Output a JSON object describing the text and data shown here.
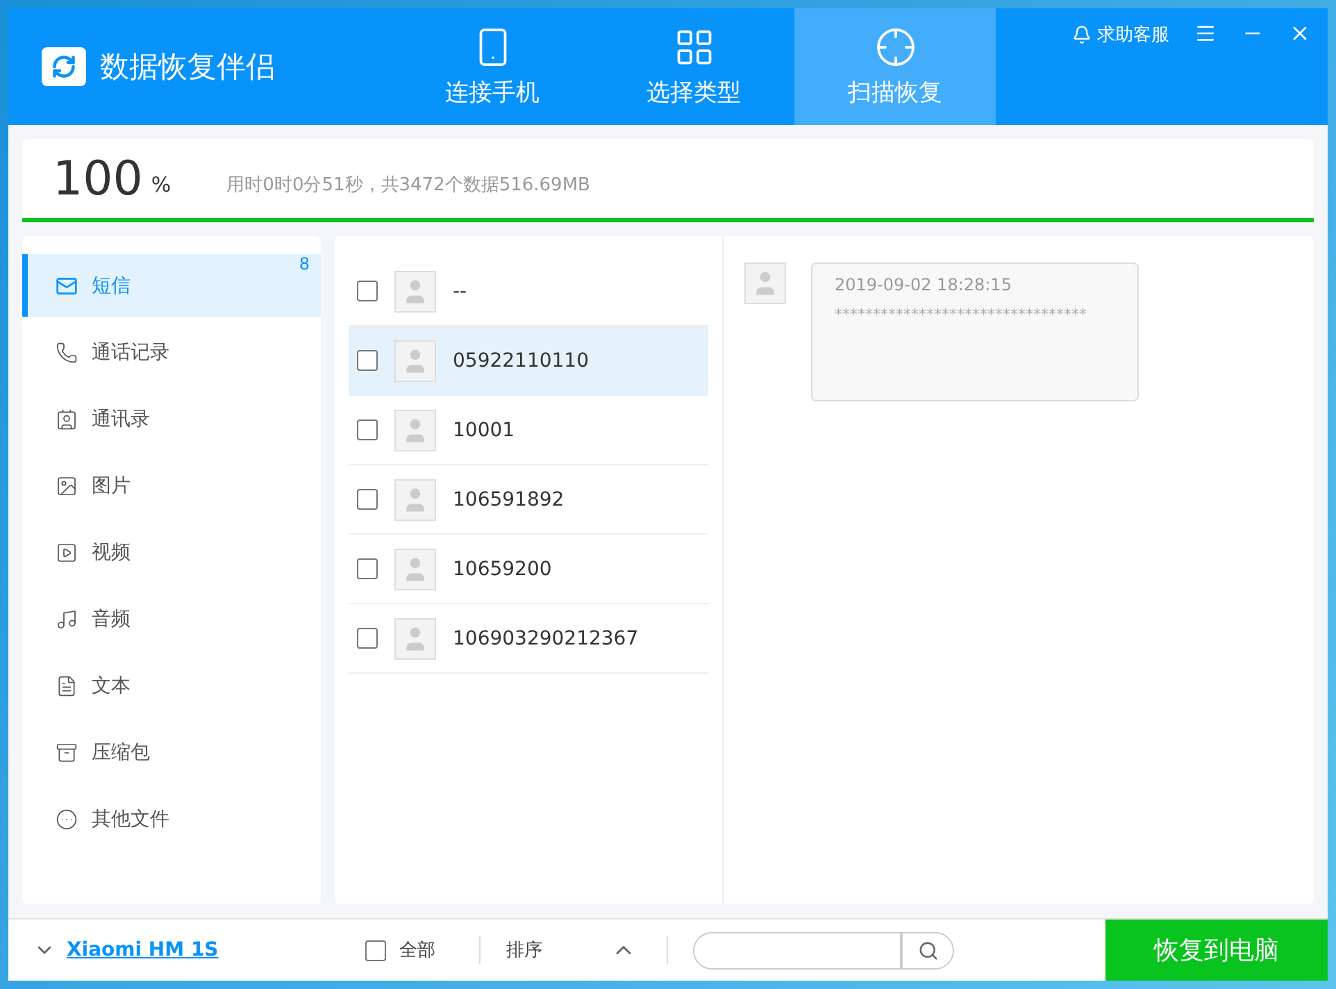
{
  "app": {
    "title": "数据恢复伴侣"
  },
  "steps": [
    {
      "label": "连接手机",
      "selected": false,
      "kind": "phone"
    },
    {
      "label": "选择类型",
      "selected": false,
      "kind": "grid"
    },
    {
      "label": "扫描恢复",
      "selected": true,
      "kind": "scan"
    }
  ],
  "help": {
    "label": "求助客服"
  },
  "progress": {
    "percent": "100",
    "unit": "%",
    "summary": "用时0时0分51秒，共3472个数据516.69MB",
    "level": 1
  },
  "categories": [
    {
      "label": "短信",
      "kind": "sms",
      "selected": true,
      "count": "8"
    },
    {
      "label": "通话记录",
      "kind": "calls",
      "selected": false
    },
    {
      "label": "通讯录",
      "kind": "contacts",
      "selected": false
    },
    {
      "label": "图片",
      "kind": "images",
      "selected": false
    },
    {
      "label": "视频",
      "kind": "video",
      "selected": false
    },
    {
      "label": "音频",
      "kind": "audio",
      "selected": false
    },
    {
      "label": "文本",
      "kind": "text",
      "selected": false
    },
    {
      "label": "压缩包",
      "kind": "archive",
      "selected": false
    },
    {
      "label": "其他文件",
      "kind": "other",
      "selected": false
    }
  ],
  "conversations": [
    {
      "name": "--",
      "checked": false,
      "selected": false
    },
    {
      "name": "05922110110",
      "checked": false,
      "selected": true
    },
    {
      "name": "10001",
      "checked": false,
      "selected": false
    },
    {
      "name": "106591892",
      "checked": false,
      "selected": false
    },
    {
      "name": "10659200",
      "checked": false,
      "selected": false
    },
    {
      "name": "106903290212367",
      "checked": false,
      "selected": false
    }
  ],
  "messages": [
    {
      "time": "2019-09-02 18:28:15",
      "text": "*********************************"
    }
  ],
  "footer": {
    "device": "Xiaomi HM 1S",
    "select_all": {
      "label": "全部",
      "checked": false
    },
    "sort": {
      "label": "排序"
    },
    "recover_button": "恢复到电脑"
  }
}
